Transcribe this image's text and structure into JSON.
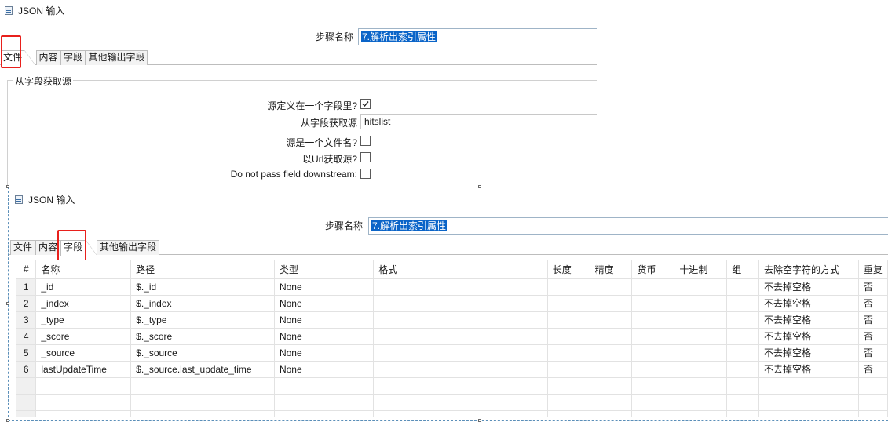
{
  "top": {
    "title": "JSON 输入",
    "step_label": "步骤名称",
    "step_value": "7.解析出索引属性",
    "tabs": [
      "文件",
      "内容",
      "字段",
      "其他输出字段"
    ],
    "group_title": "从字段获取源",
    "fields": {
      "source_in_field_label": "源定义在一个字段里?",
      "source_in_field_checked": true,
      "get_source_from_label": "从字段获取源",
      "get_source_from_value": "hitslist",
      "source_is_file_label": "源是一个文件名?",
      "source_is_file_checked": false,
      "read_url_label": "以Url获取源?",
      "read_url_checked": false,
      "no_pass_label": "Do not pass field downstream:",
      "no_pass_checked": false
    }
  },
  "bottom": {
    "title": "JSON 输入",
    "step_label": "步骤名称",
    "step_value": "7.解析出索引属性",
    "tabs": [
      "文件",
      "内容",
      "字段",
      "其他输出字段"
    ],
    "table": {
      "columns": [
        "#",
        "名称",
        "路径",
        "类型",
        "格式",
        "长度",
        "精度",
        "货币",
        "十进制",
        "组",
        "去除空字符的方式",
        "重复"
      ],
      "rows": [
        [
          "1",
          "_id",
          "$._id",
          "None",
          "",
          "",
          "",
          "",
          "",
          "",
          "不去掉空格",
          "否"
        ],
        [
          "2",
          "_index",
          "$._index",
          "None",
          "",
          "",
          "",
          "",
          "",
          "",
          "不去掉空格",
          "否"
        ],
        [
          "3",
          "_type",
          "$._type",
          "None",
          "",
          "",
          "",
          "",
          "",
          "",
          "不去掉空格",
          "否"
        ],
        [
          "4",
          "_score",
          "$._score",
          "None",
          "",
          "",
          "",
          "",
          "",
          "",
          "不去掉空格",
          "否"
        ],
        [
          "5",
          "_source",
          "$._source",
          "None",
          "",
          "",
          "",
          "",
          "",
          "",
          "不去掉空格",
          "否"
        ],
        [
          "6",
          "lastUpdateTime",
          "$._source.last_update_time",
          "None",
          "",
          "",
          "",
          "",
          "",
          "",
          "不去掉空格",
          "否"
        ]
      ]
    }
  },
  "colors": {
    "selection": "#0a64c8",
    "highlight_box": "#e8201c",
    "dashed_border": "#5b8fb9"
  }
}
